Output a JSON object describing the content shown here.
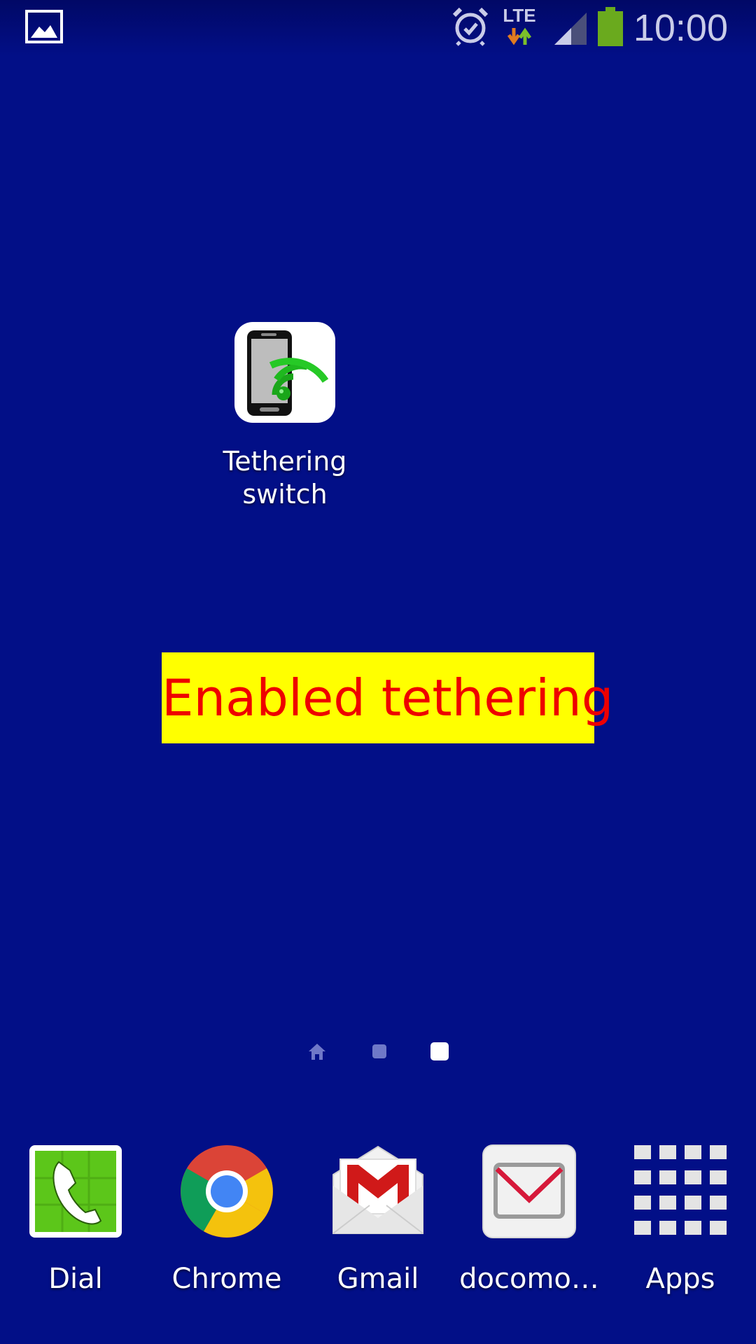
{
  "status_bar": {
    "time": "10:00",
    "network_type": "LTE",
    "icons": [
      "gallery-icon",
      "alarm-icon",
      "lte-data-icon",
      "signal-icon",
      "battery-icon"
    ],
    "battery_color": "#6aaa1e"
  },
  "home_screen": {
    "background_color": "#020f87",
    "apps": [
      {
        "label_line1": "Tethering",
        "label_line2": "switch",
        "icon": "tethering-switch-icon"
      }
    ],
    "pages": {
      "count": 3,
      "current": 3
    }
  },
  "toast": {
    "message": "Enabled tethering",
    "background": "#ffff00",
    "text_color": "#ee0000"
  },
  "dock": {
    "items": [
      {
        "label": "Dial",
        "icon": "phone-icon"
      },
      {
        "label": "Chrome",
        "icon": "chrome-icon"
      },
      {
        "label": "Gmail",
        "icon": "gmail-icon"
      },
      {
        "label": "docomo…",
        "icon": "mail-icon"
      },
      {
        "label": "Apps",
        "icon": "apps-grid-icon"
      }
    ]
  }
}
